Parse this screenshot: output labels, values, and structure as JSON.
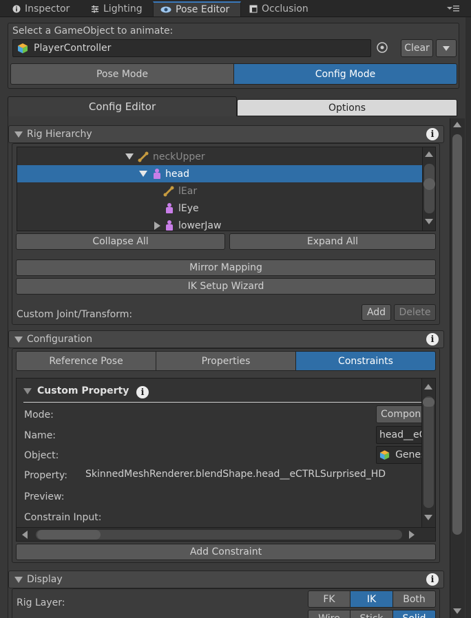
{
  "window_tabs": [
    {
      "label": "Inspector",
      "icon": "info-icon"
    },
    {
      "label": "Lighting",
      "icon": "lighting-icon"
    },
    {
      "label": "Pose Editor",
      "icon": "eye-icon"
    },
    {
      "label": "Occlusion",
      "icon": "occlusion-icon"
    }
  ],
  "select": {
    "label": "Select a GameObject to animate:",
    "object_name": "PlayerController",
    "clear_label": "Clear"
  },
  "modes": {
    "pose": "Pose Mode",
    "config": "Config Mode"
  },
  "editor_tabs": {
    "config_editor": "Config Editor",
    "options": "Options"
  },
  "rig_hierarchy": {
    "title": "Rig Hierarchy",
    "nodes": [
      {
        "label": "neckUpper",
        "type": "bone"
      },
      {
        "label": "head",
        "type": "person"
      },
      {
        "label": "lEar",
        "type": "bone"
      },
      {
        "label": "lEye",
        "type": "person"
      },
      {
        "label": "lowerJaw",
        "type": "person"
      }
    ],
    "collapse_all": "Collapse All",
    "expand_all": "Expand All",
    "mirror_mapping": "Mirror Mapping",
    "ik_setup_wizard": "IK Setup Wizard",
    "custom_joint_label": "Custom Joint/Transform:",
    "add": "Add",
    "delete": "Delete"
  },
  "configuration": {
    "title": "Configuration",
    "tabs": [
      "Reference Pose",
      "Properties",
      "Constraints"
    ],
    "active_tab": "Constraints",
    "custom_property": {
      "title": "Custom Property",
      "mode_label": "Mode:",
      "mode_value": "Component Pr",
      "name_label": "Name:",
      "name_value": "head__eCTRLS",
      "object_label": "Object:",
      "object_value": "GenesisBFe",
      "property_label": "Property:",
      "property_value": "SkinnedMeshRenderer.blendShape.head__eCTRLSurprised_HD",
      "preview_label": "Preview:",
      "constrain_input_label": "Constrain Input:"
    },
    "add_constraint": "Add Constraint"
  },
  "display": {
    "title": "Display",
    "rig_layer_label": "Rig Layer:",
    "rig_layer_options": [
      "FK",
      "IK",
      "Both"
    ],
    "rig_layer_selected": "IK",
    "render_options": [
      "Wire",
      "Stick",
      "Solid"
    ],
    "render_selected": "Solid"
  },
  "colors": {
    "accent": "#2f6ea7",
    "background": "#383838",
    "bone": "#c79b3f",
    "person": "#c97ee8"
  }
}
